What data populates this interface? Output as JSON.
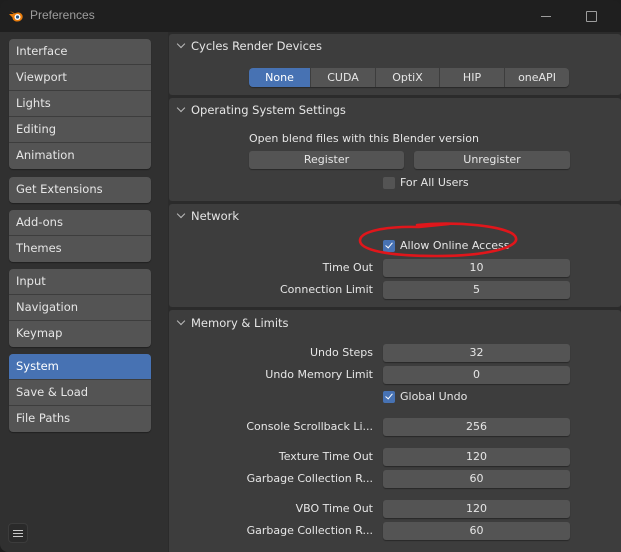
{
  "window": {
    "title": "Preferences",
    "icon": "blender-logo-icon",
    "controls": [
      "minimize-icon",
      "maximize-icon"
    ]
  },
  "sidebar": {
    "groups": [
      {
        "items": [
          {
            "label": "Interface",
            "active": false
          },
          {
            "label": "Viewport",
            "active": false
          },
          {
            "label": "Lights",
            "active": false
          },
          {
            "label": "Editing",
            "active": false
          },
          {
            "label": "Animation",
            "active": false
          }
        ]
      },
      {
        "items": [
          {
            "label": "Get Extensions",
            "active": false
          }
        ]
      },
      {
        "items": [
          {
            "label": "Add-ons",
            "active": false
          },
          {
            "label": "Themes",
            "active": false
          }
        ]
      },
      {
        "items": [
          {
            "label": "Input",
            "active": false
          },
          {
            "label": "Navigation",
            "active": false
          },
          {
            "label": "Keymap",
            "active": false
          }
        ]
      },
      {
        "items": [
          {
            "label": "System",
            "active": true
          },
          {
            "label": "Save & Load",
            "active": false
          },
          {
            "label": "File Paths",
            "active": false
          }
        ]
      }
    ],
    "menu_icon": "hamburger-menu-icon"
  },
  "panels": {
    "cycles": {
      "title": "Cycles Render Devices",
      "devices": [
        "None",
        "CUDA",
        "OptiX",
        "HIP",
        "oneAPI"
      ],
      "selected": "None"
    },
    "os": {
      "title": "Operating System Settings",
      "description": "Open blend files with this Blender version",
      "register_label": "Register",
      "unregister_label": "Unregister",
      "for_all_users_label": "For All Users",
      "for_all_users_checked": false
    },
    "network": {
      "title": "Network",
      "allow_online_label": "Allow Online Access",
      "allow_online_checked": true,
      "timeout_label": "Time Out",
      "timeout_value": "10",
      "connection_limit_label": "Connection Limit",
      "connection_limit_value": "5"
    },
    "memory": {
      "title": "Memory & Limits",
      "undo_steps_label": "Undo Steps",
      "undo_steps_value": "32",
      "undo_memory_label": "Undo Memory Limit",
      "undo_memory_value": "0",
      "global_undo_label": "Global Undo",
      "global_undo_checked": true,
      "console_label": "Console Scrollback Li...",
      "console_value": "256",
      "texture_timeout_label": "Texture Time Out",
      "texture_timeout_value": "120",
      "gc_rate_label_1": "Garbage Collection R...",
      "gc_rate_value_1": "60",
      "vbo_timeout_label": "VBO Time Out",
      "vbo_timeout_value": "120",
      "gc_rate_label_2": "Garbage Collection R...",
      "gc_rate_value_2": "60"
    }
  },
  "annotation": {
    "color": "#e0161b",
    "target": "Allow Online Access"
  },
  "colors": {
    "accent": "#4772b3",
    "panel": "#3d3d3d",
    "widget": "#545454",
    "background": "#2b2b2b"
  }
}
